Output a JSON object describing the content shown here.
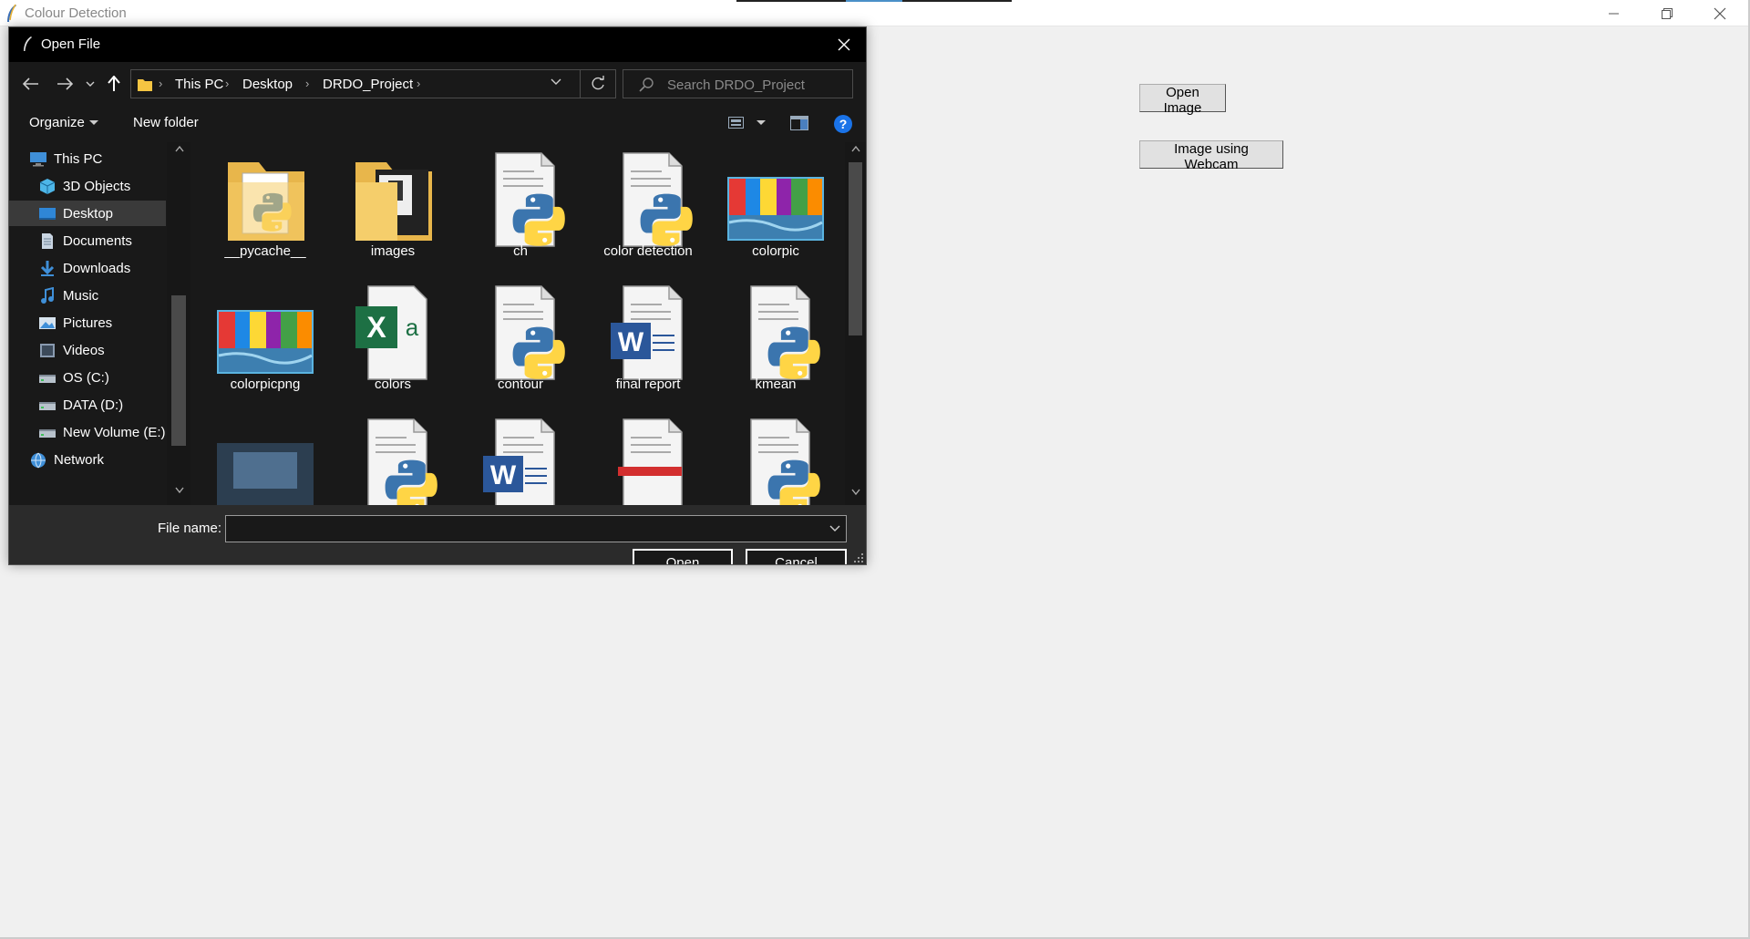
{
  "main_window": {
    "title": "Colour Detection",
    "buttons": {
      "open_image": "Open Image",
      "webcam": "Image using Webcam"
    }
  },
  "dialog": {
    "title": "Open File",
    "breadcrumb": [
      "This PC",
      "Desktop",
      "DRDO_Project"
    ],
    "search_placeholder": "Search DRDO_Project",
    "toolbar": {
      "organize": "Organize",
      "new_folder": "New folder",
      "help": "?"
    },
    "nav_items": [
      {
        "label": "This PC",
        "icon": "computer-icon"
      },
      {
        "label": "3D Objects",
        "icon": "cube-icon"
      },
      {
        "label": "Desktop",
        "icon": "desktop-icon",
        "selected": true
      },
      {
        "label": "Documents",
        "icon": "document-icon"
      },
      {
        "label": "Downloads",
        "icon": "download-icon"
      },
      {
        "label": "Music",
        "icon": "music-icon"
      },
      {
        "label": "Pictures",
        "icon": "picture-icon"
      },
      {
        "label": "Videos",
        "icon": "video-icon"
      },
      {
        "label": "OS (C:)",
        "icon": "drive-icon"
      },
      {
        "label": "DATA (D:)",
        "icon": "drive-icon"
      },
      {
        "label": "New Volume (E:)",
        "icon": "drive-icon"
      },
      {
        "label": "Network",
        "icon": "network-icon"
      }
    ],
    "files": [
      {
        "label": "__pycache__",
        "type": "folder-python"
      },
      {
        "label": "images",
        "type": "folder-images"
      },
      {
        "label": "ch",
        "type": "python"
      },
      {
        "label": "color detection",
        "type": "python"
      },
      {
        "label": "colorpic",
        "type": "image"
      },
      {
        "label": "colorpicpng",
        "type": "image"
      },
      {
        "label": "colors",
        "type": "excel"
      },
      {
        "label": "contour",
        "type": "python"
      },
      {
        "label": "final report",
        "type": "word"
      },
      {
        "label": "kmean",
        "type": "python"
      },
      {
        "label": "",
        "type": "image-dark"
      },
      {
        "label": "",
        "type": "python"
      },
      {
        "label": "",
        "type": "word"
      },
      {
        "label": "",
        "type": "pdf"
      },
      {
        "label": "",
        "type": "python"
      }
    ],
    "filename_label": "File name:",
    "filename_value": "",
    "open_button": "Open",
    "cancel_button": "Cancel"
  },
  "colors": {
    "dialog_bg": "#2b2b2b",
    "pane_bg": "#191919",
    "selected": "#3a3a3a",
    "help_blue": "#1a73e8"
  }
}
